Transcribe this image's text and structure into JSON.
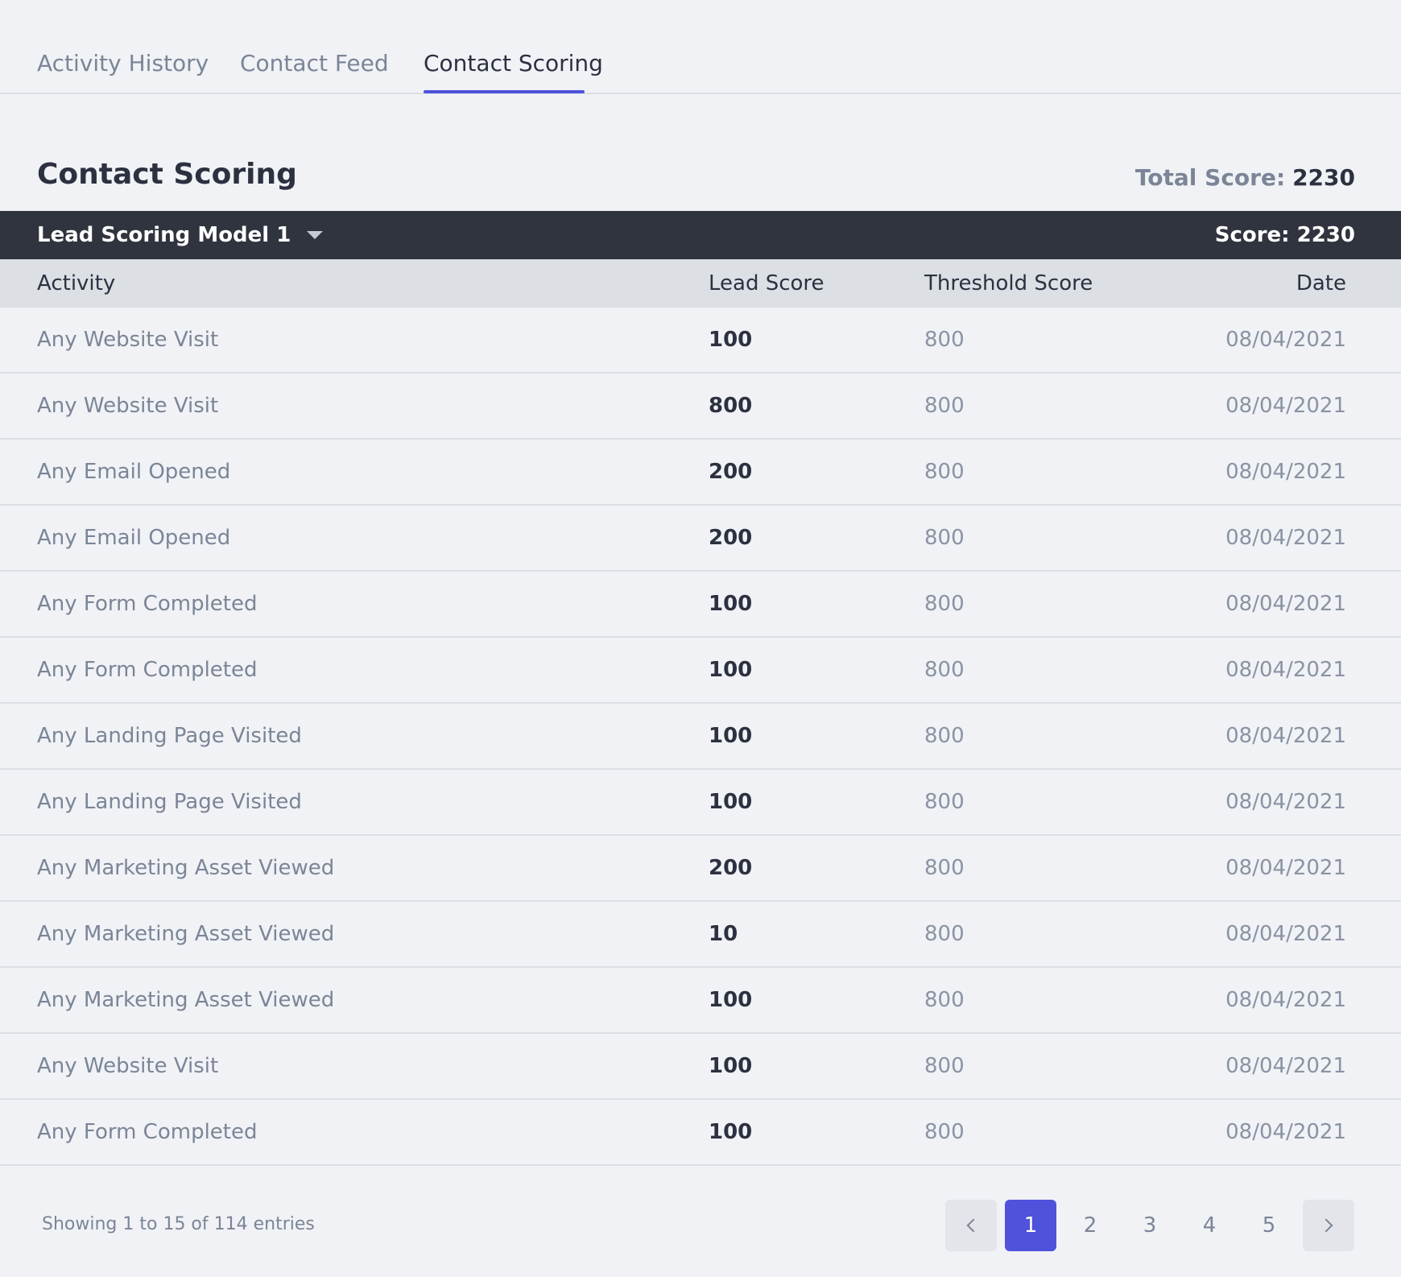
{
  "tabs": [
    {
      "label": "Activity History",
      "active": false
    },
    {
      "label": "Contact Feed",
      "active": false
    },
    {
      "label": "Contact Scoring",
      "active": true
    }
  ],
  "section": {
    "title": "Contact Scoring",
    "total_score_label": "Total Score:",
    "total_score_value": "2230"
  },
  "model": {
    "selected": "Lead Scoring Model 1",
    "score_text": "Score: 2230"
  },
  "table": {
    "headers": [
      "Activity",
      "Lead Score",
      "Threshold Score",
      "Date"
    ],
    "rows": [
      {
        "activity": "Any Website Visit",
        "lead": "100",
        "threshold": "800",
        "date": "08/04/2021"
      },
      {
        "activity": "Any Website Visit",
        "lead": "800",
        "threshold": "800",
        "date": "08/04/2021"
      },
      {
        "activity": "Any Email Opened",
        "lead": "200",
        "threshold": "800",
        "date": "08/04/2021"
      },
      {
        "activity": "Any Email Opened",
        "lead": "200",
        "threshold": "800",
        "date": "08/04/2021"
      },
      {
        "activity": "Any Form Completed",
        "lead": "100",
        "threshold": "800",
        "date": "08/04/2021"
      },
      {
        "activity": "Any Form Completed",
        "lead": "100",
        "threshold": "800",
        "date": "08/04/2021"
      },
      {
        "activity": "Any Landing Page Visited",
        "lead": "100",
        "threshold": "800",
        "date": "08/04/2021"
      },
      {
        "activity": "Any Landing Page Visited",
        "lead": "100",
        "threshold": "800",
        "date": "08/04/2021"
      },
      {
        "activity": "Any Marketing Asset Viewed",
        "lead": "200",
        "threshold": "800",
        "date": "08/04/2021"
      },
      {
        "activity": "Any Marketing Asset Viewed",
        "lead": "10",
        "threshold": "800",
        "date": "08/04/2021"
      },
      {
        "activity": "Any Marketing Asset Viewed",
        "lead": "100",
        "threshold": "800",
        "date": "08/04/2021"
      },
      {
        "activity": "Any Website Visit",
        "lead": "100",
        "threshold": "800",
        "date": "08/04/2021"
      },
      {
        "activity": "Any Form Completed",
        "lead": "100",
        "threshold": "800",
        "date": "08/04/2021"
      }
    ]
  },
  "pagination": {
    "info": "Showing 1 to 15 of 114 entries",
    "pages": [
      "1",
      "2",
      "3",
      "4",
      "5"
    ],
    "current": "1",
    "prev_icon": "chevron-left-icon",
    "next_icon": "chevron-right-icon"
  },
  "colors": {
    "accent": "#4f52db",
    "model_bar": "#30343f",
    "header_bg": "#dcdfe4",
    "page_bg": "#f0f2f6"
  }
}
